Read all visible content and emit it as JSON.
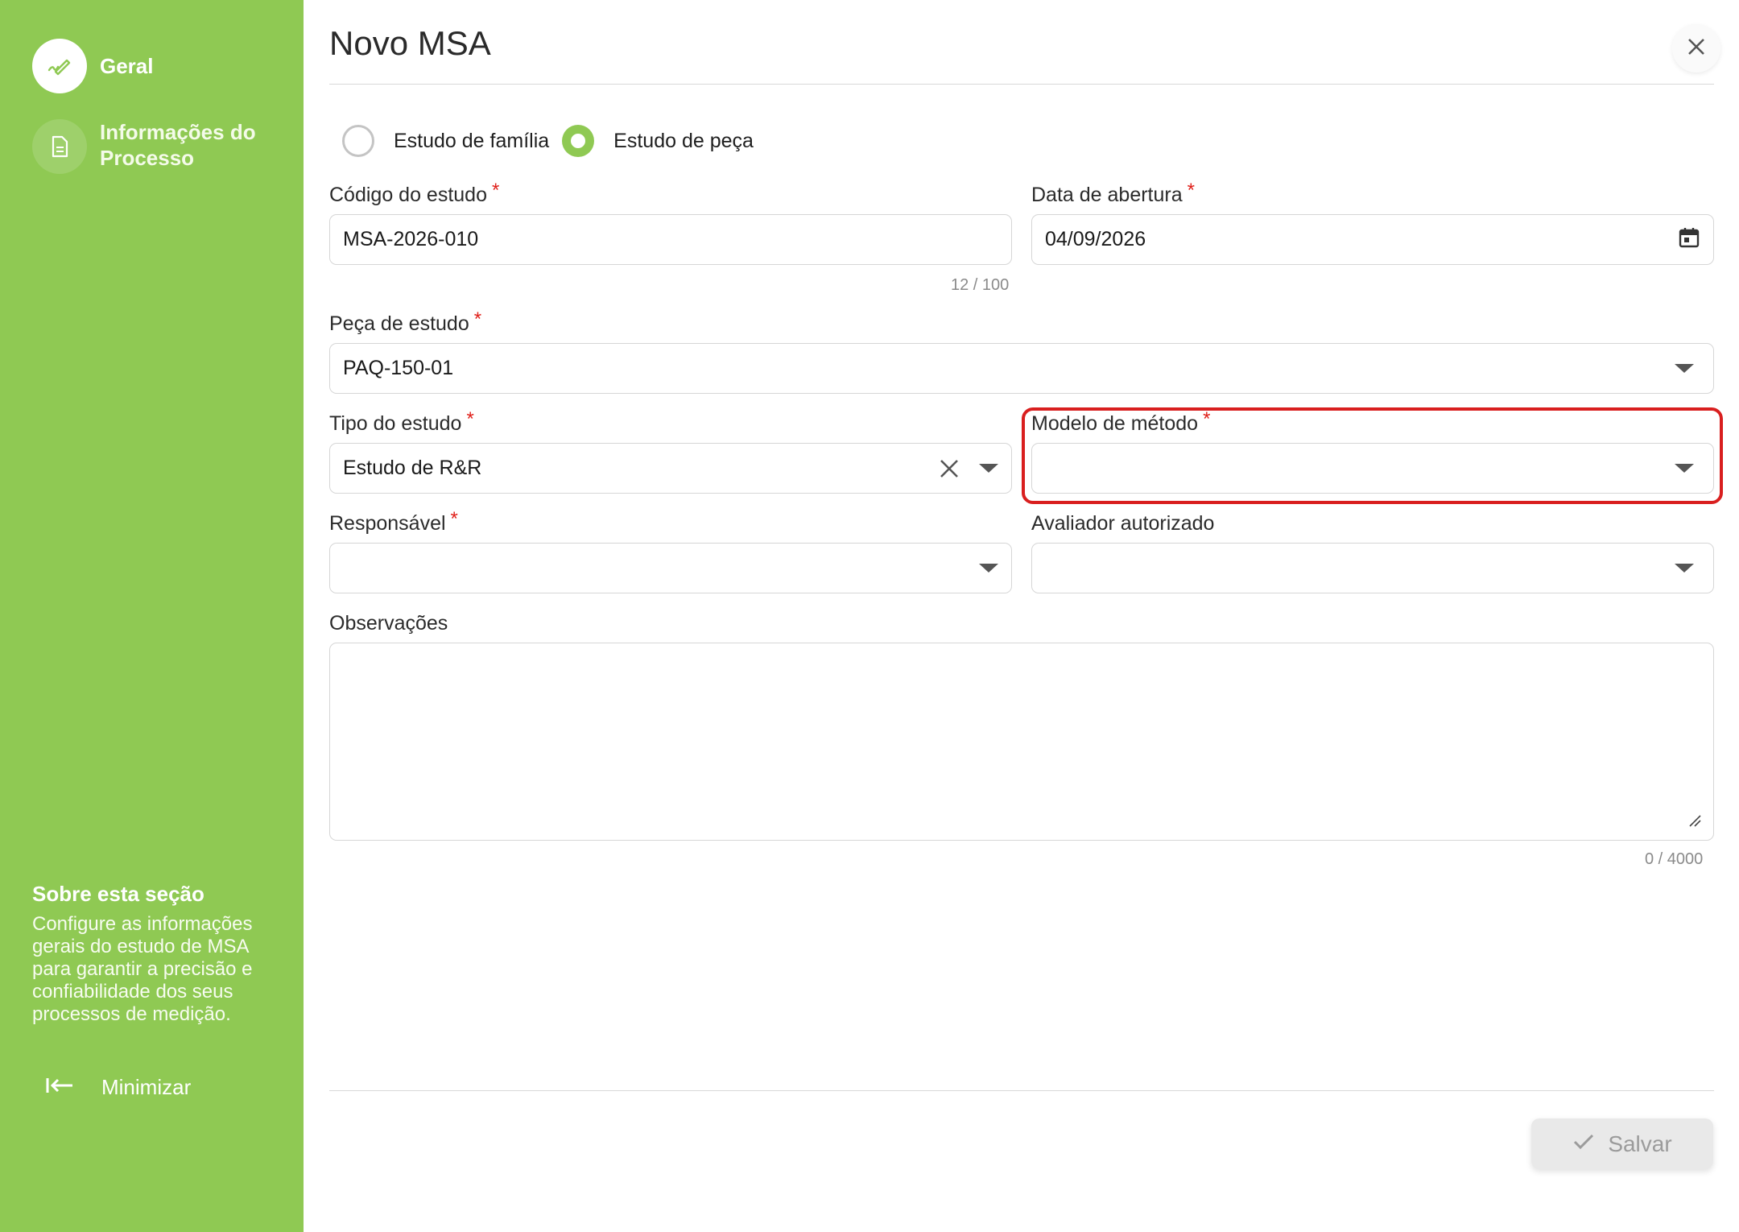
{
  "sidebar": {
    "items": [
      {
        "label": "Geral",
        "icon": "pencil-icon",
        "active": true
      },
      {
        "label": "Informações do Processo",
        "icon": "document-icon",
        "active": false
      }
    ],
    "about_title": "Sobre esta seção",
    "about_text": "Configure as informações gerais do estudo de MSA para garantir a precisão e confiabilidade dos seus processos de medição.",
    "minimize_label": "Minimizar"
  },
  "dialog": {
    "title": "Novo MSA",
    "close_icon": "close-icon"
  },
  "form": {
    "study_type_radio": {
      "options": [
        {
          "label": "Estudo de família",
          "checked": false
        },
        {
          "label": "Estudo de peça",
          "checked": true
        }
      ]
    },
    "codigo": {
      "label": "Código do estudo",
      "required": "*",
      "value": "MSA-2026-010",
      "counter": "12 / 100"
    },
    "data_abertura": {
      "label": "Data de abertura",
      "required": "*",
      "value": "04/09/2026",
      "icon": "calendar-icon"
    },
    "peca": {
      "label": "Peça de estudo",
      "required": "*",
      "value": "PAQ-150-01"
    },
    "tipo": {
      "label": "Tipo do estudo",
      "required": "*",
      "value": "Estudo de R&R"
    },
    "modelo": {
      "label": "Modelo de método",
      "required": "*",
      "value": ""
    },
    "responsavel": {
      "label": "Responsável",
      "required": "*",
      "value": ""
    },
    "avaliador": {
      "label": "Avaliador autorizado",
      "value": ""
    },
    "observacoes": {
      "label": "Observações",
      "value": "",
      "counter": "0 / 4000"
    }
  },
  "footer": {
    "save_label": "Salvar"
  },
  "colors": {
    "sidebar_bg": "#8fc953",
    "accent": "#8fc953",
    "required": "#e0201a",
    "highlight": "#d91f1f"
  }
}
